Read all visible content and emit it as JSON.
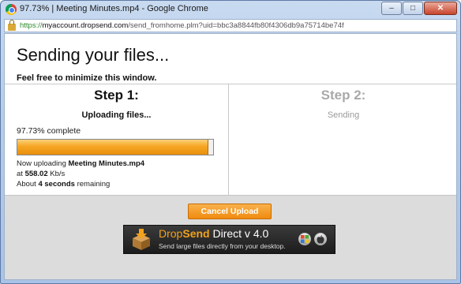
{
  "window": {
    "title": "97.73% | Meeting Minutes.mp4 - Google Chrome",
    "controls": {
      "minimize": "–",
      "maximize": "□",
      "close": "✕"
    }
  },
  "address_bar": {
    "scheme": "https://",
    "host": "myaccount.dropsend.com",
    "path": "/send_fromhome.plm?uid=bbc3a8844fb80f4306db9a75714be74f"
  },
  "page": {
    "heading": "Sending your files...",
    "minimize_note": "Feel free to minimize this window.",
    "step1": {
      "title": "Step 1:",
      "subtitle": "Uploading files..."
    },
    "step2": {
      "title": "Step 2:",
      "subtitle": "Sending"
    },
    "progress": {
      "percent_text": "97.73% complete",
      "fraction": 0.9773
    },
    "upload_info": {
      "now_uploading_prefix": "Now uploading ",
      "file_name": "Meeting Minutes.mp4",
      "at_prefix": "at ",
      "speed": "558.02",
      "speed_unit": " Kb/s",
      "about_prefix": "About ",
      "remaining_time": "4 seconds",
      "remaining_suffix": " remaining"
    },
    "cancel_label": "Cancel Upload",
    "banner": {
      "brand_part1": "Drop",
      "brand_part2": "Send",
      "brand_part3": " Direct v 4.0",
      "tagline": "Send large files directly from your desktop."
    }
  },
  "colors": {
    "accent_orange": "#f5a623",
    "banner_bg": "#1c1c1c",
    "footer_bg": "#dcdcdc"
  }
}
